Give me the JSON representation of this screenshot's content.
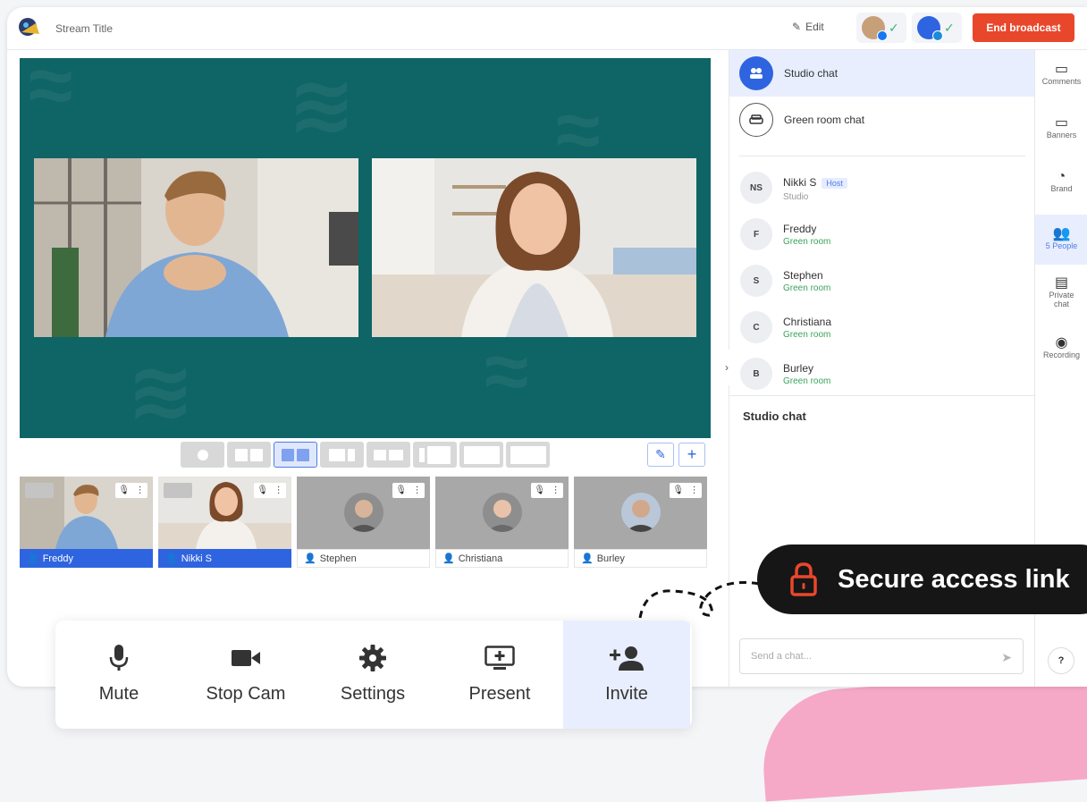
{
  "header": {
    "stream_title": "Stream Title",
    "edit_label": "Edit",
    "end_broadcast_label": "End broadcast",
    "colors": {
      "end_broadcast": "#e9472b",
      "accent": "#2f64e0",
      "stage": "#0f6466"
    }
  },
  "stage": {
    "layouts": [
      "single",
      "two-side",
      "two-active",
      "three",
      "host-large",
      "triple-left",
      "solo-small",
      "empty"
    ],
    "active_layout": "two-active"
  },
  "participants": [
    {
      "name": "Freddy",
      "on_stage": true
    },
    {
      "name": "Nikki S",
      "on_stage": true
    },
    {
      "name": "Stephen",
      "on_stage": false
    },
    {
      "name": "Christiana",
      "on_stage": false
    },
    {
      "name": "Burley",
      "on_stage": false
    }
  ],
  "panel": {
    "studio_chat": "Studio chat",
    "green_room_chat": "Green room chat",
    "people": [
      {
        "initials": "NS",
        "name": "Nikki S",
        "status": "Studio",
        "badge": "Host"
      },
      {
        "initials": "F",
        "name": "Freddy",
        "status": "Green room"
      },
      {
        "initials": "S",
        "name": "Stephen",
        "status": "Green room"
      },
      {
        "initials": "C",
        "name": "Christiana",
        "status": "Green room"
      },
      {
        "initials": "B",
        "name": "Burley",
        "status": "Green room"
      }
    ],
    "chat_heading": "Studio chat",
    "chat_placeholder": "Send a chat..."
  },
  "rail": {
    "items": [
      {
        "label": "Comments",
        "icon": "comment-icon"
      },
      {
        "label": "Banners",
        "icon": "banner-icon"
      },
      {
        "label": "Brand",
        "icon": "palette-icon"
      },
      {
        "label": "5 People",
        "icon": "people-icon"
      },
      {
        "label": "Private chat",
        "icon": "private-chat-icon"
      },
      {
        "label": "Recording",
        "icon": "record-icon"
      }
    ],
    "help": "?"
  },
  "controls": [
    {
      "label": "Mute",
      "icon": "microphone-icon"
    },
    {
      "label": "Stop Cam",
      "icon": "camera-icon"
    },
    {
      "label": "Settings",
      "icon": "gear-icon"
    },
    {
      "label": "Present",
      "icon": "present-icon"
    },
    {
      "label": "Invite",
      "icon": "add-user-icon"
    }
  ],
  "callout": {
    "text": "Secure access link"
  }
}
